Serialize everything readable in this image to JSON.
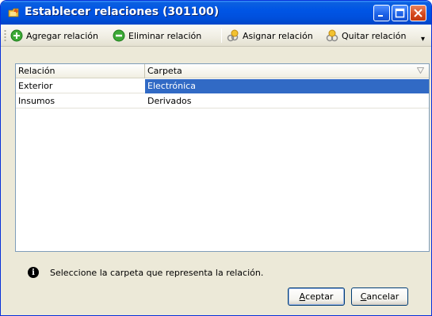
{
  "window": {
    "title": "Establecer relaciones (301100)",
    "controls": {
      "minimize": "minimize",
      "maximize": "maximize",
      "close": "close"
    }
  },
  "toolbar": {
    "add_relation": "Agregar relación",
    "remove_relation": "Eliminar relación",
    "assign_relation": "Asignar relación",
    "unassign_relation": "Quitar relación",
    "overflow": "▾"
  },
  "table": {
    "columns": [
      "Relación",
      "Carpeta"
    ],
    "rows": [
      {
        "relacion": "Exterior",
        "carpeta": "Electrónica",
        "selected": true
      },
      {
        "relacion": "Insumos",
        "carpeta": "Derivados",
        "selected": false
      }
    ]
  },
  "status": {
    "message": "Seleccione la carpeta que representa la relación."
  },
  "buttons": {
    "accept_prefix": "A",
    "accept_rest": "ceptar",
    "cancel_prefix": "C",
    "cancel_rest": "ancelar"
  },
  "colors": {
    "titlebar": "#0055e5",
    "selection": "#316ac5",
    "window_bg": "#ece9d8"
  }
}
